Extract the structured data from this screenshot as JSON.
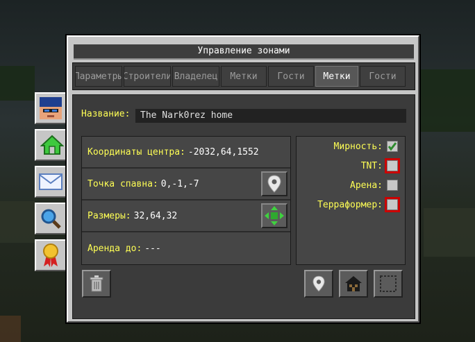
{
  "window": {
    "title": "Управление зонами"
  },
  "tabs": [
    {
      "label": "Параметры",
      "selected": false
    },
    {
      "label": "Строители",
      "selected": false
    },
    {
      "label": "Владелец",
      "selected": false
    },
    {
      "label": "Метки",
      "selected": false
    },
    {
      "label": "Гости",
      "selected": false
    },
    {
      "label": "Метки",
      "selected": true
    },
    {
      "label": "Гости",
      "selected": false
    }
  ],
  "zone": {
    "name_label": "Название:",
    "name_value": "The Nark0rez home",
    "center_label": "Координаты центра:",
    "center_value": "-2032,64,1552",
    "spawn_label": "Точка спавна:",
    "spawn_value": "0,-1,-7",
    "size_label": "Размеры:",
    "size_value": "32,64,32",
    "rent_label": "Аренда до:",
    "rent_value": "---"
  },
  "flags": [
    {
      "label": "Мирность:",
      "checked": true,
      "highlighted": false
    },
    {
      "label": "TNT:",
      "checked": false,
      "highlighted": true
    },
    {
      "label": "Арена:",
      "checked": false,
      "highlighted": false
    },
    {
      "label": "Терраформер:",
      "checked": false,
      "highlighted": true
    }
  ],
  "sidebar": [
    "user-skin-icon",
    "home-icon",
    "mail-icon",
    "search-icon",
    "award-ribbon-icon"
  ],
  "colors": {
    "label_yellow": "#ffff55",
    "check_green": "#2e8b2e",
    "flag_highlight": "#cc0000"
  }
}
